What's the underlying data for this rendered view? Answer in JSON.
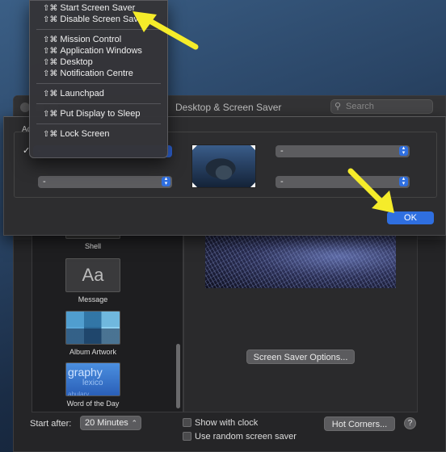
{
  "window": {
    "title": "Desktop & Screen Saver",
    "search_placeholder": "Search"
  },
  "sidebar": {
    "items": [
      {
        "label": "Shell"
      },
      {
        "label": "Message",
        "thumb_text": "Aa"
      },
      {
        "label": "Album Artwork"
      },
      {
        "label": "Word of the Day",
        "thumb_words": [
          "graphy",
          "lexico",
          "abulary"
        ]
      }
    ]
  },
  "preview": {
    "options_button": "Screen Saver Options..."
  },
  "bottom": {
    "start_after_label": "Start after:",
    "start_after_value": "20 Minutes",
    "show_with_clock": "Show with clock",
    "use_random": "Use random screen saver",
    "hot_corners_button": "Hot Corners...",
    "help": "?"
  },
  "sheet": {
    "label_partial": "Ac",
    "corners": {
      "top_left": "-",
      "top_right": "-",
      "bottom_left": "-",
      "bottom_right": "-"
    },
    "ok_label": "OK"
  },
  "menu": {
    "modifiers": "⇧⌘",
    "groups": [
      [
        "Start Screen Saver",
        "Disable Screen Saver"
      ],
      [
        "Mission Control",
        "Application Windows",
        "Desktop",
        "Notification Centre"
      ],
      [
        "Launchpad"
      ],
      [
        "Put Display to Sleep"
      ],
      [
        "Lock Screen"
      ]
    ]
  },
  "colors": {
    "accent": "#2f6fe0",
    "annotation_arrow": "#f5ec2a"
  }
}
